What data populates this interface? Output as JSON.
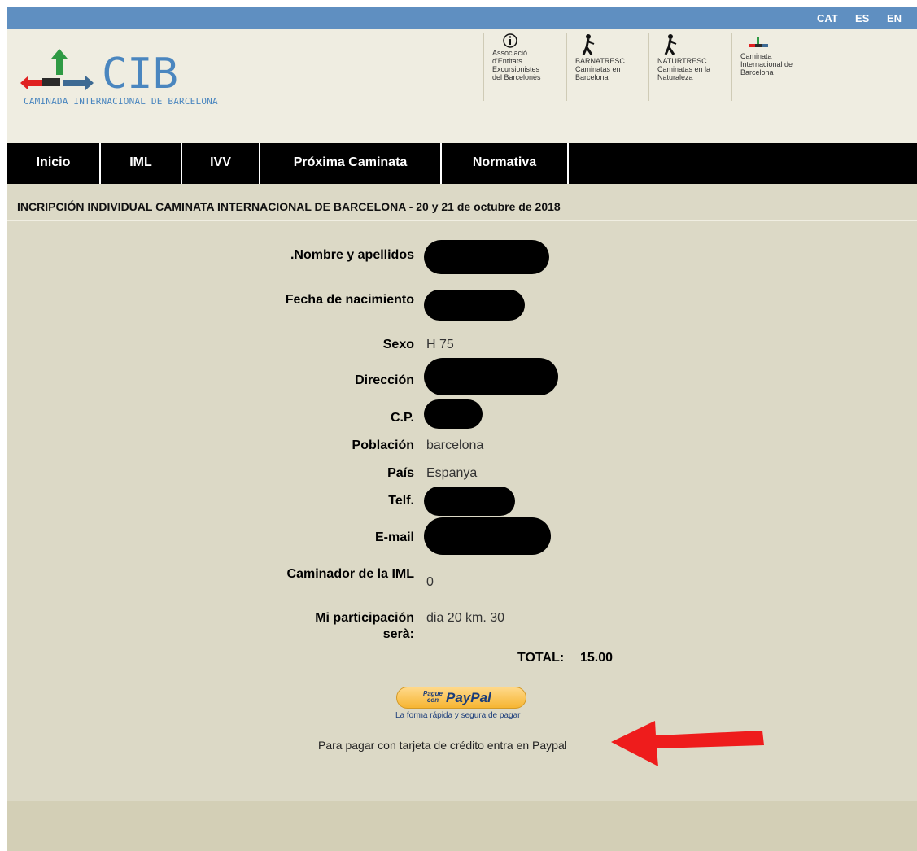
{
  "lang": {
    "cat": "CAT",
    "es": "ES",
    "en": "EN"
  },
  "logo": {
    "text": "CIB",
    "subtitle": "CAMINADA INTERNACIONAL DE BARCELONA"
  },
  "partners": [
    {
      "icon": "info-icon",
      "text": "Associació\nd'Entitats\nExcursionistes\ndel Barcelonès"
    },
    {
      "icon": "hiker-icon",
      "text": "BARNATRESC\nCaminatas en\nBarcelona"
    },
    {
      "icon": "hiker-icon",
      "text": "NATURTRESC\nCaminatas en la\nNaturaleza"
    },
    {
      "icon": "mini-logo-icon",
      "text": "Caminata\nInternacional de\nBarcelona"
    }
  ],
  "nav": [
    "Inicio",
    "IML",
    "IVV",
    "Próxima Caminata",
    "Normativa"
  ],
  "title": "INCRIPCIÓN INDIVIDUAL CAMINATA INTERNACIONAL DE BARCELONA - 20 y 21 de octubre de 2018",
  "form": {
    "nombre_label": ".Nombre y apellidos",
    "fecha_label": "Fecha de nacimiento",
    "sexo_label": "Sexo",
    "sexo_value": "H 75",
    "direccion_label": "Dirección",
    "cp_label": "C.P.",
    "poblacion_label": "Población",
    "poblacion_value": "barcelona",
    "pais_label": "País",
    "pais_value": "Espanya",
    "telf_label": "Telf.",
    "email_label": "E-mail",
    "caminador_label": "Caminador de la IML",
    "caminador_value": "0",
    "participacion_label": "Mi participación serà:",
    "participacion_value": "dia 20 km. 30"
  },
  "total": {
    "label": "TOTAL:",
    "value": "15.00"
  },
  "paypal": {
    "pague": "Pague con",
    "word": "PayPal",
    "tagline": "La forma rápida y segura de pagar"
  },
  "pay_note": "Para pagar con tarjeta de crédito entra en Paypal",
  "colors": {
    "lang_bar": "#5f8fc1",
    "background": "#dcd9c6",
    "header": "#efede1",
    "nav": "#000000",
    "arrow": "#ee1c1c"
  }
}
